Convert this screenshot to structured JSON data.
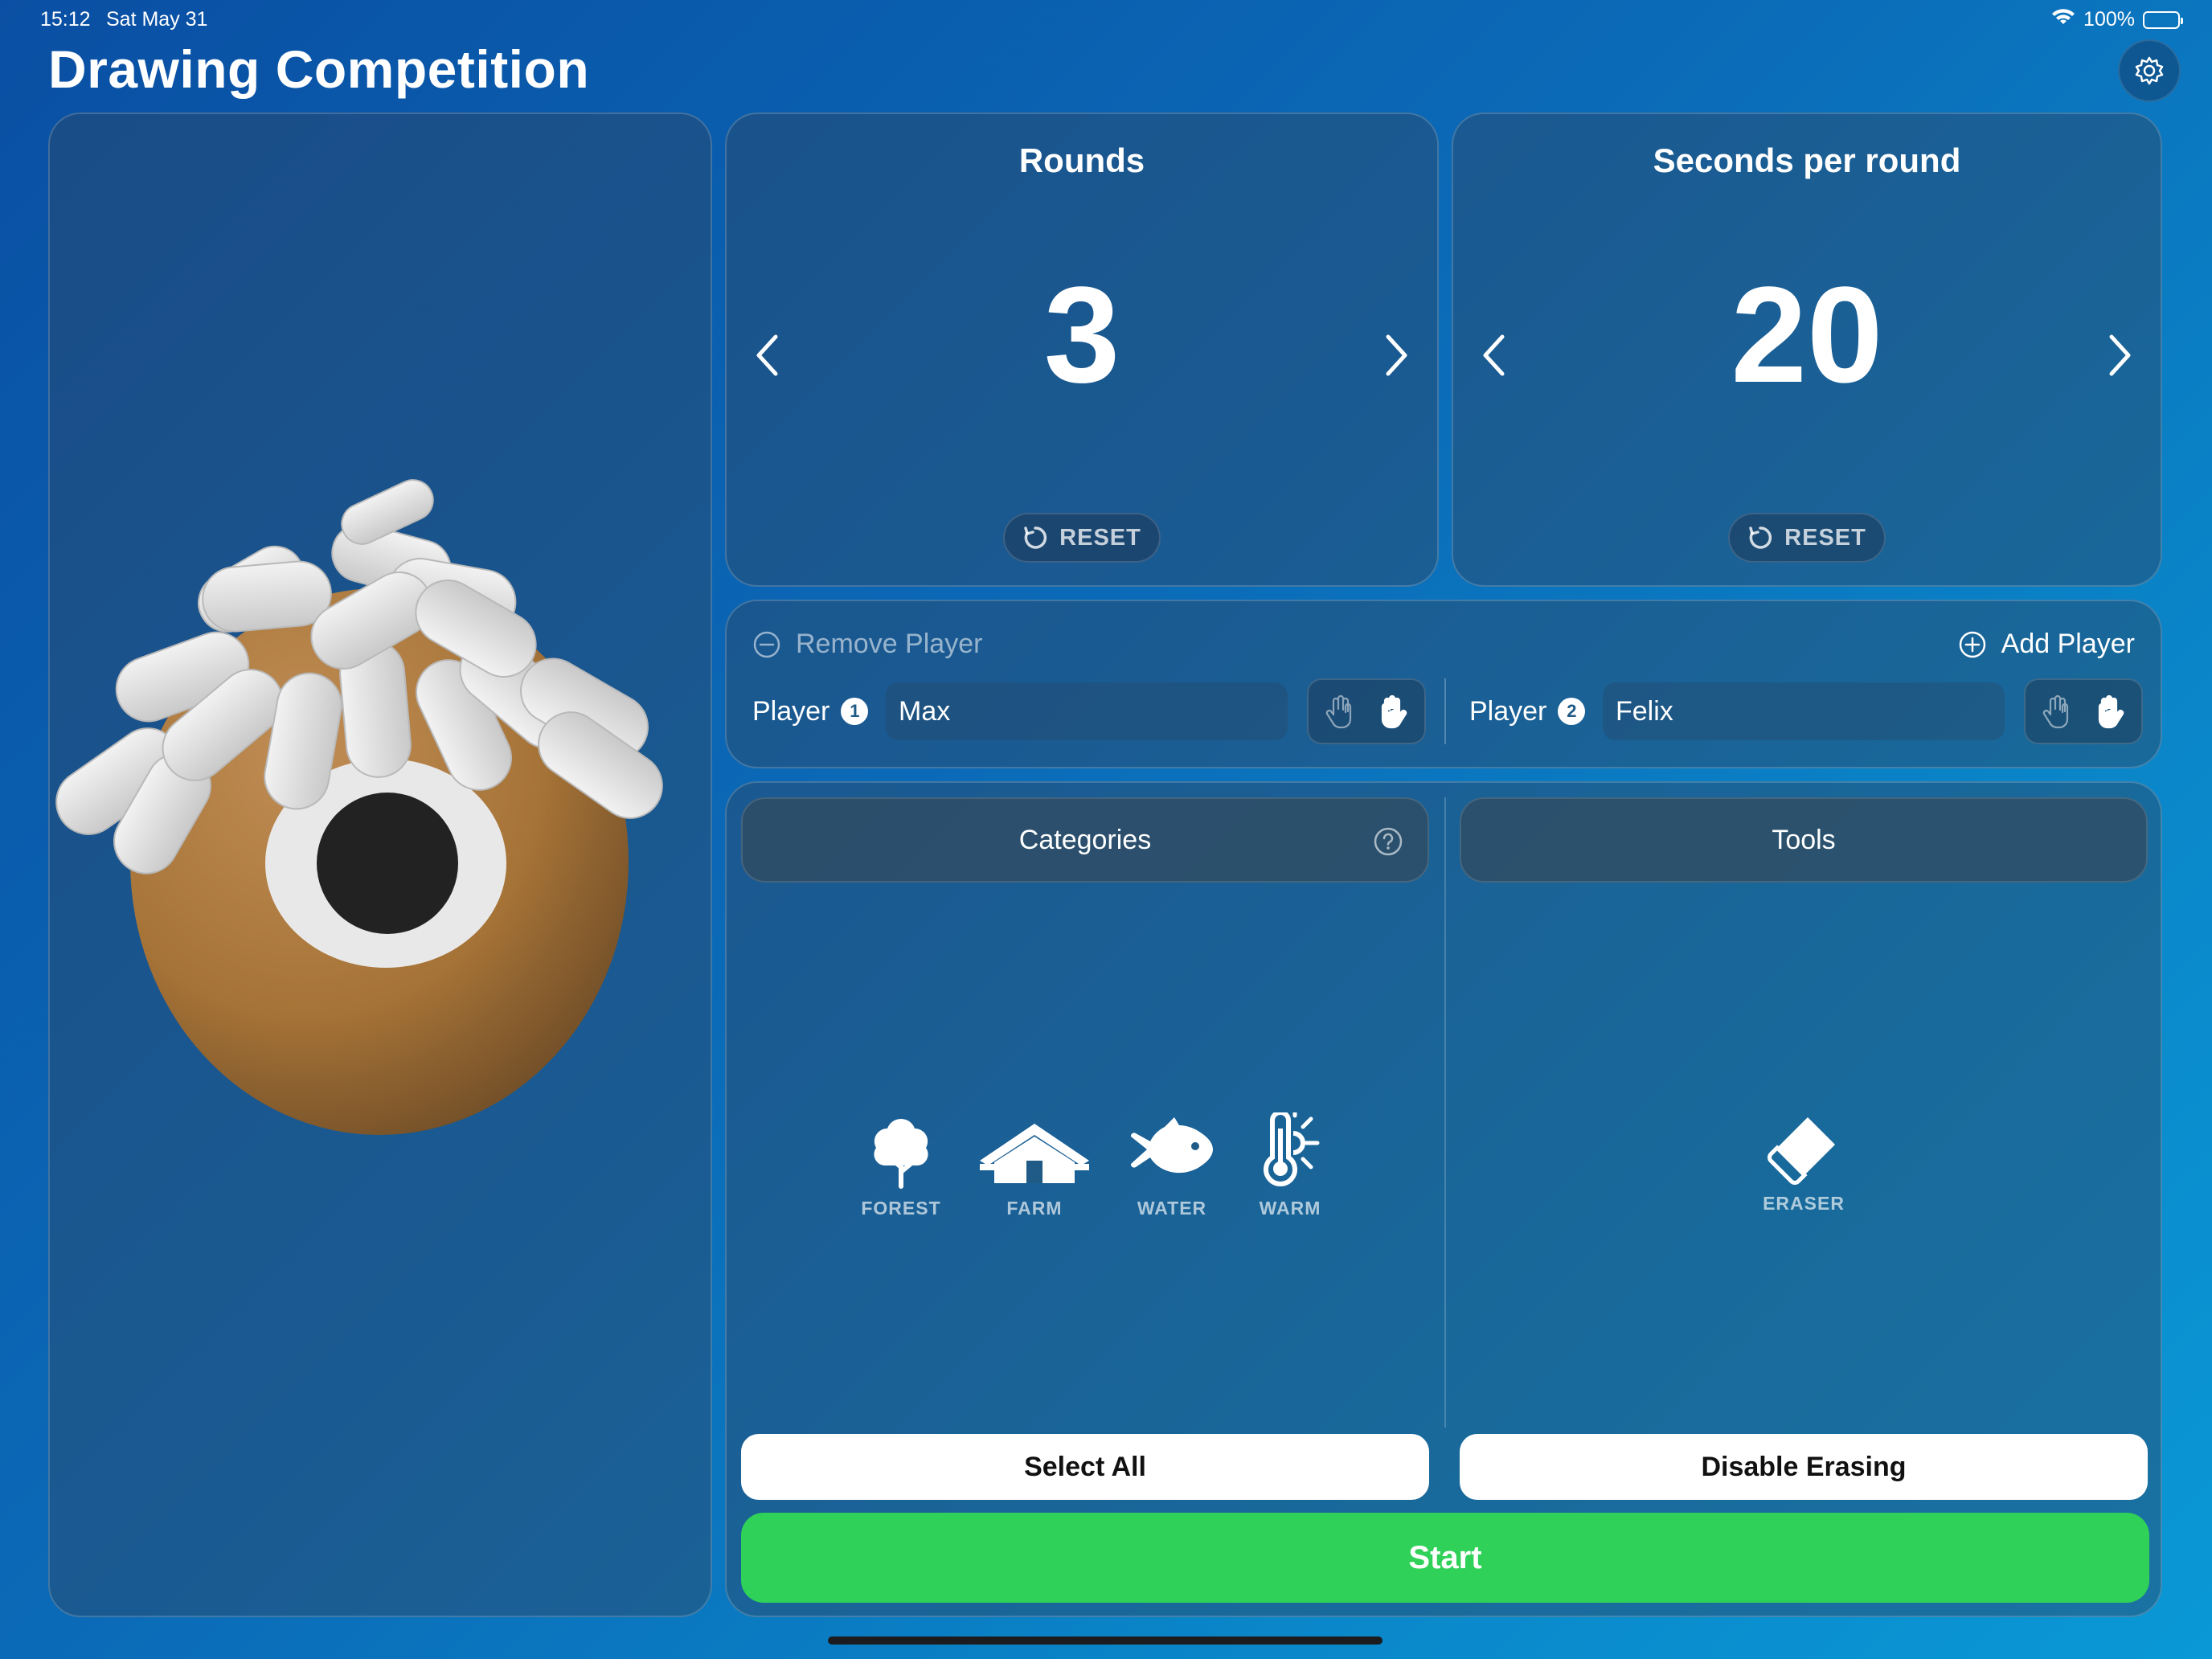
{
  "status_bar": {
    "time": "15:12",
    "date": "Sat May 31",
    "battery": "100%"
  },
  "header": {
    "title": "Drawing Competition",
    "settings_icon": "gear-icon"
  },
  "rounds": {
    "title": "Rounds",
    "value": "3",
    "reset_label": "RESET"
  },
  "seconds": {
    "title": "Seconds per round",
    "value": "20",
    "reset_label": "RESET"
  },
  "players": {
    "remove_label": "Remove Player",
    "add_label": "Add Player",
    "list": [
      {
        "label": "Player",
        "number": "1",
        "name": "Max"
      },
      {
        "label": "Player",
        "number": "2",
        "name": "Felix"
      }
    ]
  },
  "categories": {
    "header": "Categories",
    "items": [
      {
        "label": "FOREST",
        "icon": "tree-icon"
      },
      {
        "label": "FARM",
        "icon": "barn-icon"
      },
      {
        "label": "WATER",
        "icon": "fish-icon"
      },
      {
        "label": "WARM",
        "icon": "thermometer-sun-icon"
      }
    ],
    "select_all": "Select All"
  },
  "tools": {
    "header": "Tools",
    "items": [
      {
        "label": "ERASER",
        "icon": "eraser-icon"
      }
    ],
    "disable_erasing": "Disable Erasing"
  },
  "start": {
    "label": "Start",
    "color": "#30d158"
  },
  "colors": {
    "accent_green": "#30d158",
    "background_blue": "#0b6bb8"
  }
}
